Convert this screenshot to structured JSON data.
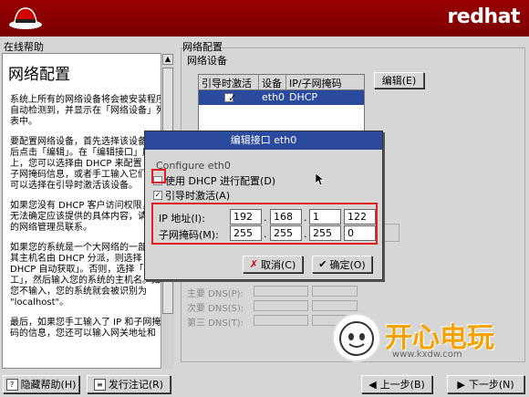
{
  "header": {
    "brand": "redhat"
  },
  "help": {
    "section_label": "在线帮助",
    "title": "网络配置",
    "paragraphs": [
      "系统上所有的网络设备将会被安装程序自动检测到，并显示在「网络设备」列表中。",
      "要配置网络设备，首先选择该设备，然后点击「编辑」。在「编辑接口」屏幕上，您可以选择由 DHCP 来配置 IP 和子网掩码信息，或者手工输入它们。您可以选择在引导时激活该设备。",
      "如果您没有 DHCP 客户访问权限，或者无法确定应该提供的具体内容，请与您的网络管理员联系。",
      "如果您的系统是一个大网络的一部分，其主机名由 DHCP 分派，则选择「通过 DHCP 自动获取」。否则，选择「手工」，然后输入您的系统的主机名。如果您不输入，您的系统就会被识别为 \"localhost\"。",
      "最后，如果您手工输入了 IP 和子网掩码的信息，您还可以输入网关地址和"
    ]
  },
  "config": {
    "section_label": "网络配置",
    "devices_label": "网络设备",
    "columns": [
      "引导时激活",
      "设备",
      "IP/子网掩码"
    ],
    "rows": [
      {
        "active": "✓",
        "device": "eth0",
        "ip": "DHCP"
      }
    ],
    "edit_button": "编辑(E)",
    "dns": [
      "主要 DNS(P):",
      "次要 DNS(S):",
      "第三 DNS(T):"
    ]
  },
  "dialog": {
    "title": "编辑接口 eth0",
    "section": "Configure eth0",
    "use_dhcp": "使用 DHCP 进行配置(D)",
    "activate_on_boot": "引导时激活(A)",
    "ip_label": "IP 地址(I):",
    "mask_label": "子网掩码(M):",
    "ip": [
      "192",
      "168",
      "1",
      "122"
    ],
    "mask": [
      "255",
      "255",
      "255",
      "0"
    ],
    "cancel_button": "取消(C)",
    "ok_button": "确定(O)"
  },
  "footer": {
    "hide_help": "隐藏帮助(H)",
    "release_notes": "发行注记(R)",
    "back": "上一步(B)",
    "next": "下一步(N)"
  },
  "watermark": {
    "name": "开心电玩",
    "url": "www.kxdw.com"
  }
}
